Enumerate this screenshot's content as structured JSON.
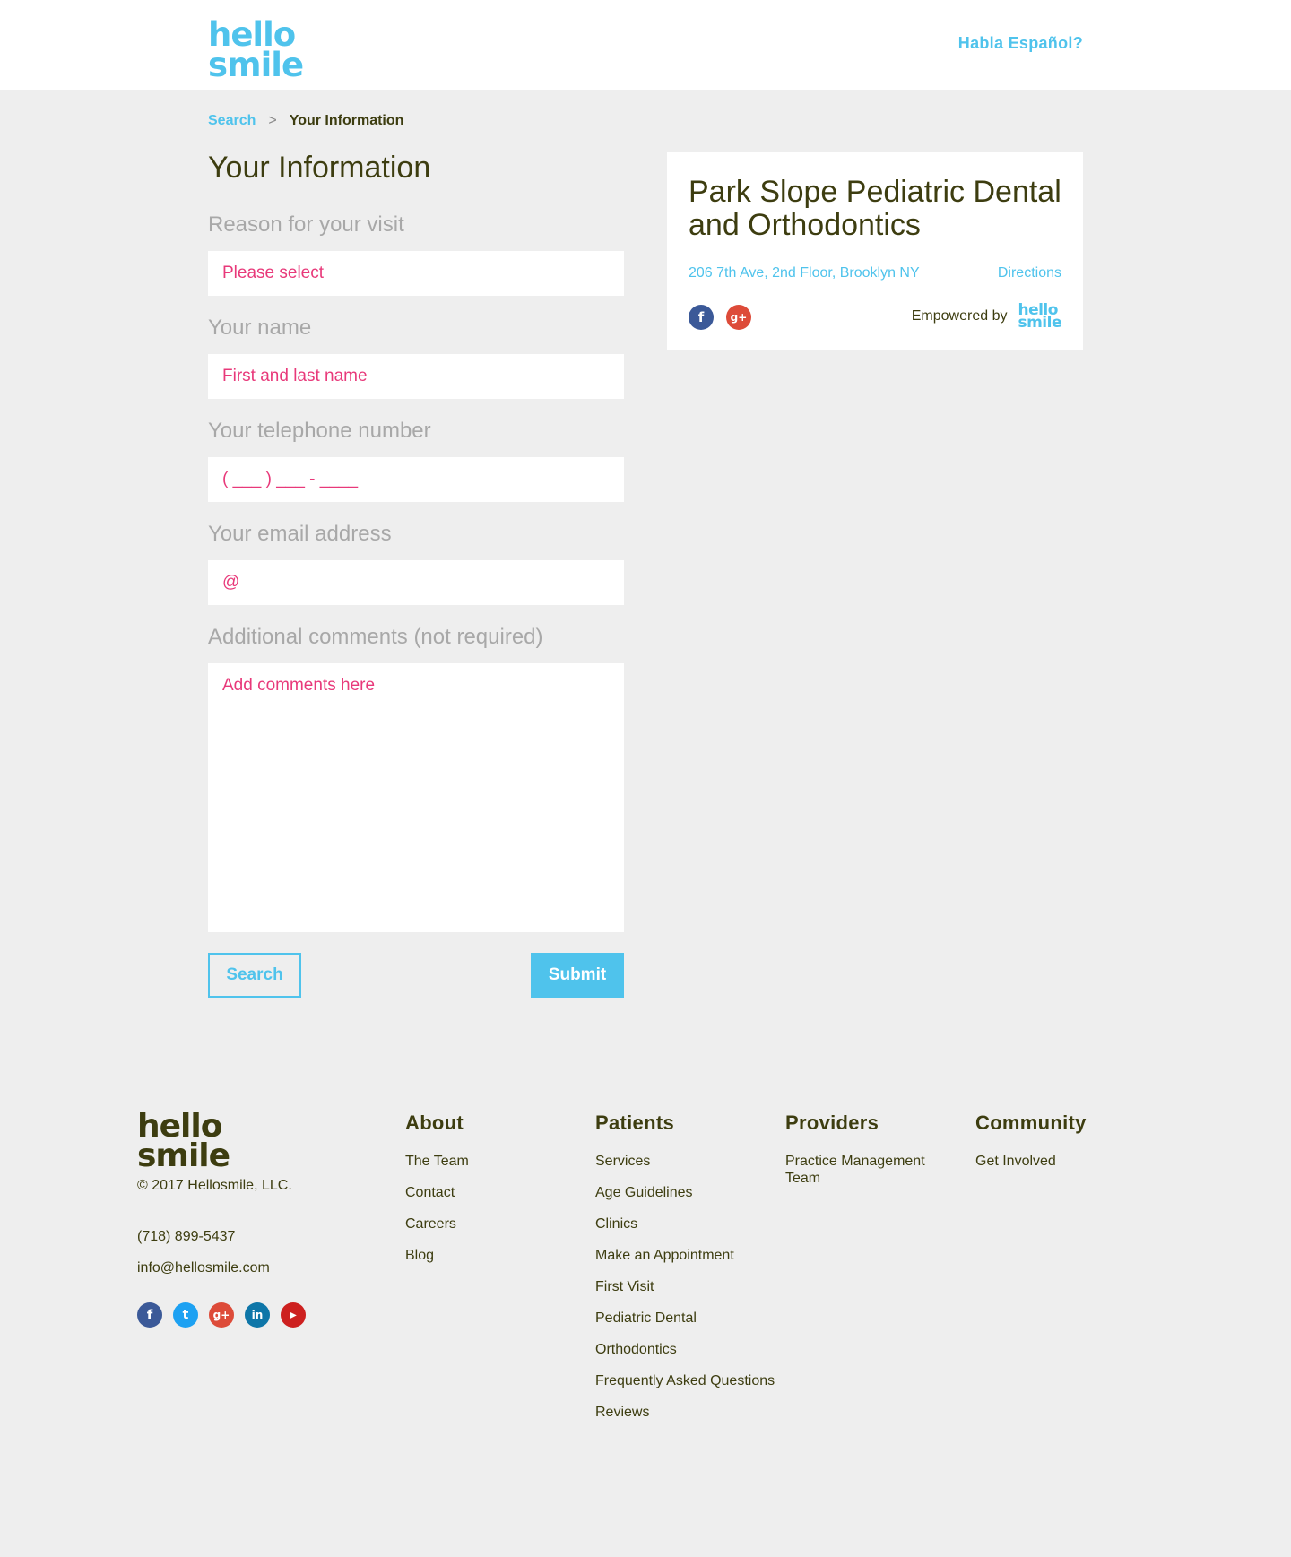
{
  "header": {
    "logo_line1": "hello",
    "logo_line2": "smile",
    "language_link": "Habla Español?"
  },
  "breadcrumb": {
    "items": [
      "Search",
      "Your Information"
    ],
    "separator": ">"
  },
  "form": {
    "title": "Your Information",
    "reason_label": "Reason for your visit",
    "reason_value": "Please select",
    "name_label": "Your name",
    "name_placeholder": "First and last name",
    "phone_label": "Your telephone number",
    "phone_placeholder": "( ___ ) ___ - ____",
    "email_label": "Your email address",
    "email_placeholder": "@",
    "comments_label": "Additional comments (not required)",
    "comments_placeholder": "Add comments here",
    "search_button": "Search",
    "submit_button": "Submit"
  },
  "clinic": {
    "name": "Park Slope Pediatric Dental and Orthodontics",
    "address": "206 7th Ave, 2nd Floor, Brooklyn NY",
    "directions": "Directions",
    "empowered_by": "Empowered by",
    "logo_line1": "hello",
    "logo_line2": "smile",
    "social_icons": [
      "facebook-icon",
      "google-plus-icon"
    ]
  },
  "footer": {
    "logo_line1": "hello",
    "logo_line2": "smile",
    "copyright": "© 2017 Hellosmile, LLC.",
    "phone": "(718) 899-5437",
    "email": "info@hellosmile.com",
    "social_icons": [
      "facebook-icon",
      "twitter-icon",
      "google-plus-icon",
      "linkedin-icon",
      "youtube-icon"
    ],
    "columns": [
      {
        "heading": "About",
        "links": [
          "The Team",
          "Contact",
          "Careers",
          "Blog"
        ]
      },
      {
        "heading": "Patients",
        "links": [
          "Services",
          "Age Guidelines",
          "Clinics",
          "Make an Appointment",
          "First Visit",
          "Pediatric Dental",
          "Orthodontics",
          "Frequently Asked Questions",
          "Reviews"
        ]
      },
      {
        "heading": "Providers",
        "links": [
          "Practice Management Team"
        ]
      },
      {
        "heading": "Community",
        "links": [
          "Get Involved"
        ]
      }
    ]
  },
  "colors": {
    "brand_blue": "#4fc3ec",
    "placeholder_pink": "#e8397a",
    "text_dark": "#3d3d10",
    "background": "#eeeeee"
  }
}
